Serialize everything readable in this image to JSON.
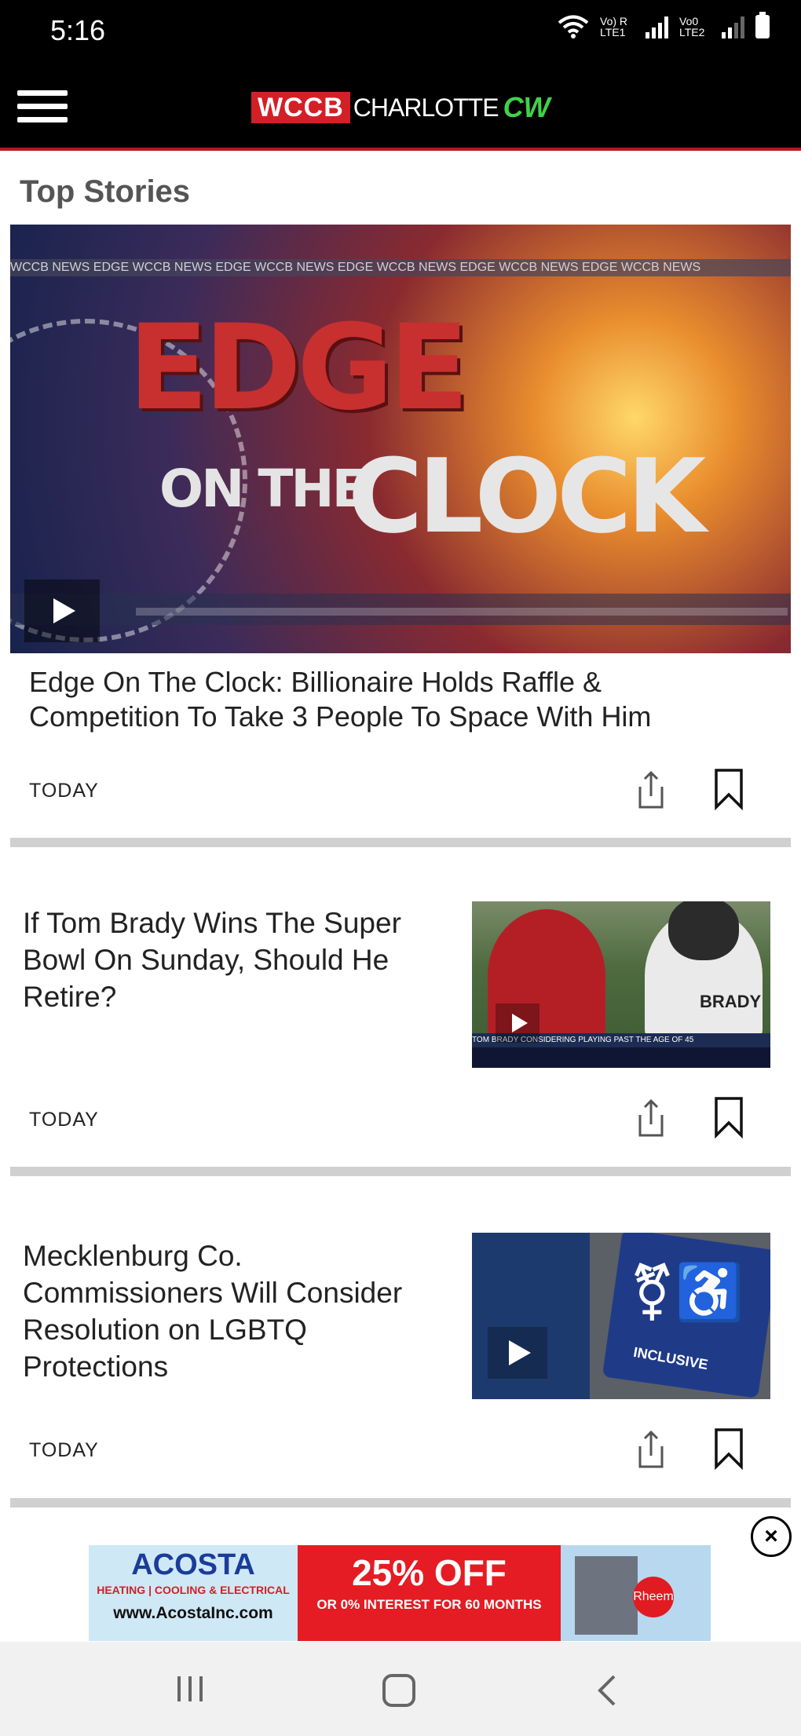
{
  "status_bar": {
    "time": "5:16",
    "sim1": "Vo) R LTE1",
    "sim2": "Vo0 LTE2"
  },
  "app_bar": {
    "logo_wccb": "WCCB",
    "logo_city": "CHARLOTTE",
    "logo_cw": "CW"
  },
  "section_title": "Top Stories",
  "hero": {
    "ticker": "WCCB NEWS EDGE WCCB NEWS EDGE WCCB NEWS EDGE WCCB NEWS EDGE WCCB NEWS EDGE WCCB NEWS",
    "edge": "EDGE",
    "on_the": "ON THE",
    "clock": "CLOCK"
  },
  "stories": [
    {
      "headline": "Edge On The Clock: Billionaire Holds Raffle & Competition To Take 3 People To Space With Him",
      "time": "TODAY"
    },
    {
      "headline": "If Tom Brady Wins The Super Bowl On Sunday, Should He Retire?",
      "time": "TODAY",
      "thumb_text": "BRADY",
      "thumb_caption": "TOM BRADY CONSIDERING PLAYING PAST THE AGE OF 45"
    },
    {
      "headline": "Mecklenburg Co. Commissioners Will Consider Resolution on LGBTQ Protections",
      "time": "TODAY",
      "thumb_text": "INCLUSIVE"
    }
  ],
  "ad": {
    "brand": "ACOSTA",
    "services": "HEATING | COOLING & ELECTRICAL",
    "url": "www.AcostaInc.com",
    "offer": "25% OFF",
    "offer_sub": "OR 0% INTEREST FOR 60 MONTHS",
    "partner": "Rheem"
  },
  "colors": {
    "brand_red": "#d32027",
    "cw_green": "#3fd24a",
    "app_bar": "#000000"
  }
}
